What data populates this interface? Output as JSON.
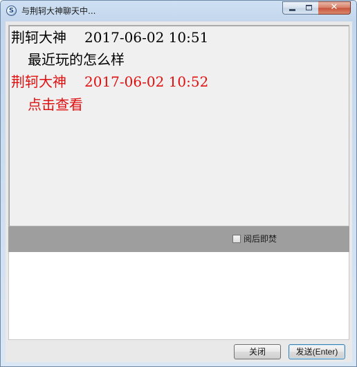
{
  "window": {
    "title": "与荆轲大神聊天中...",
    "app_icon": "S",
    "icon_name": "chat-app-icon",
    "close_glyph": "✕"
  },
  "messages": [
    {
      "sender": "荆轲大神",
      "time": "2017-06-02 10:51",
      "text": "最近玩的怎么样",
      "color": "#000000"
    },
    {
      "sender": "荆轲大神",
      "time": "2017-06-02 10:52",
      "text": "点击查看",
      "color": "#e01010"
    }
  ],
  "toolbar": {
    "burn_after_reading_label": "阅后即焚",
    "burn_after_reading_checked": false
  },
  "compose": {
    "value": "",
    "placeholder": ""
  },
  "buttons": {
    "close_label": "关闭",
    "send_label": "发送(Enter)"
  },
  "colors": {
    "toolbar_bg": "#9e9e9e",
    "message_pane_bg": "#f0f0f0",
    "highlight_red": "#e01010"
  }
}
